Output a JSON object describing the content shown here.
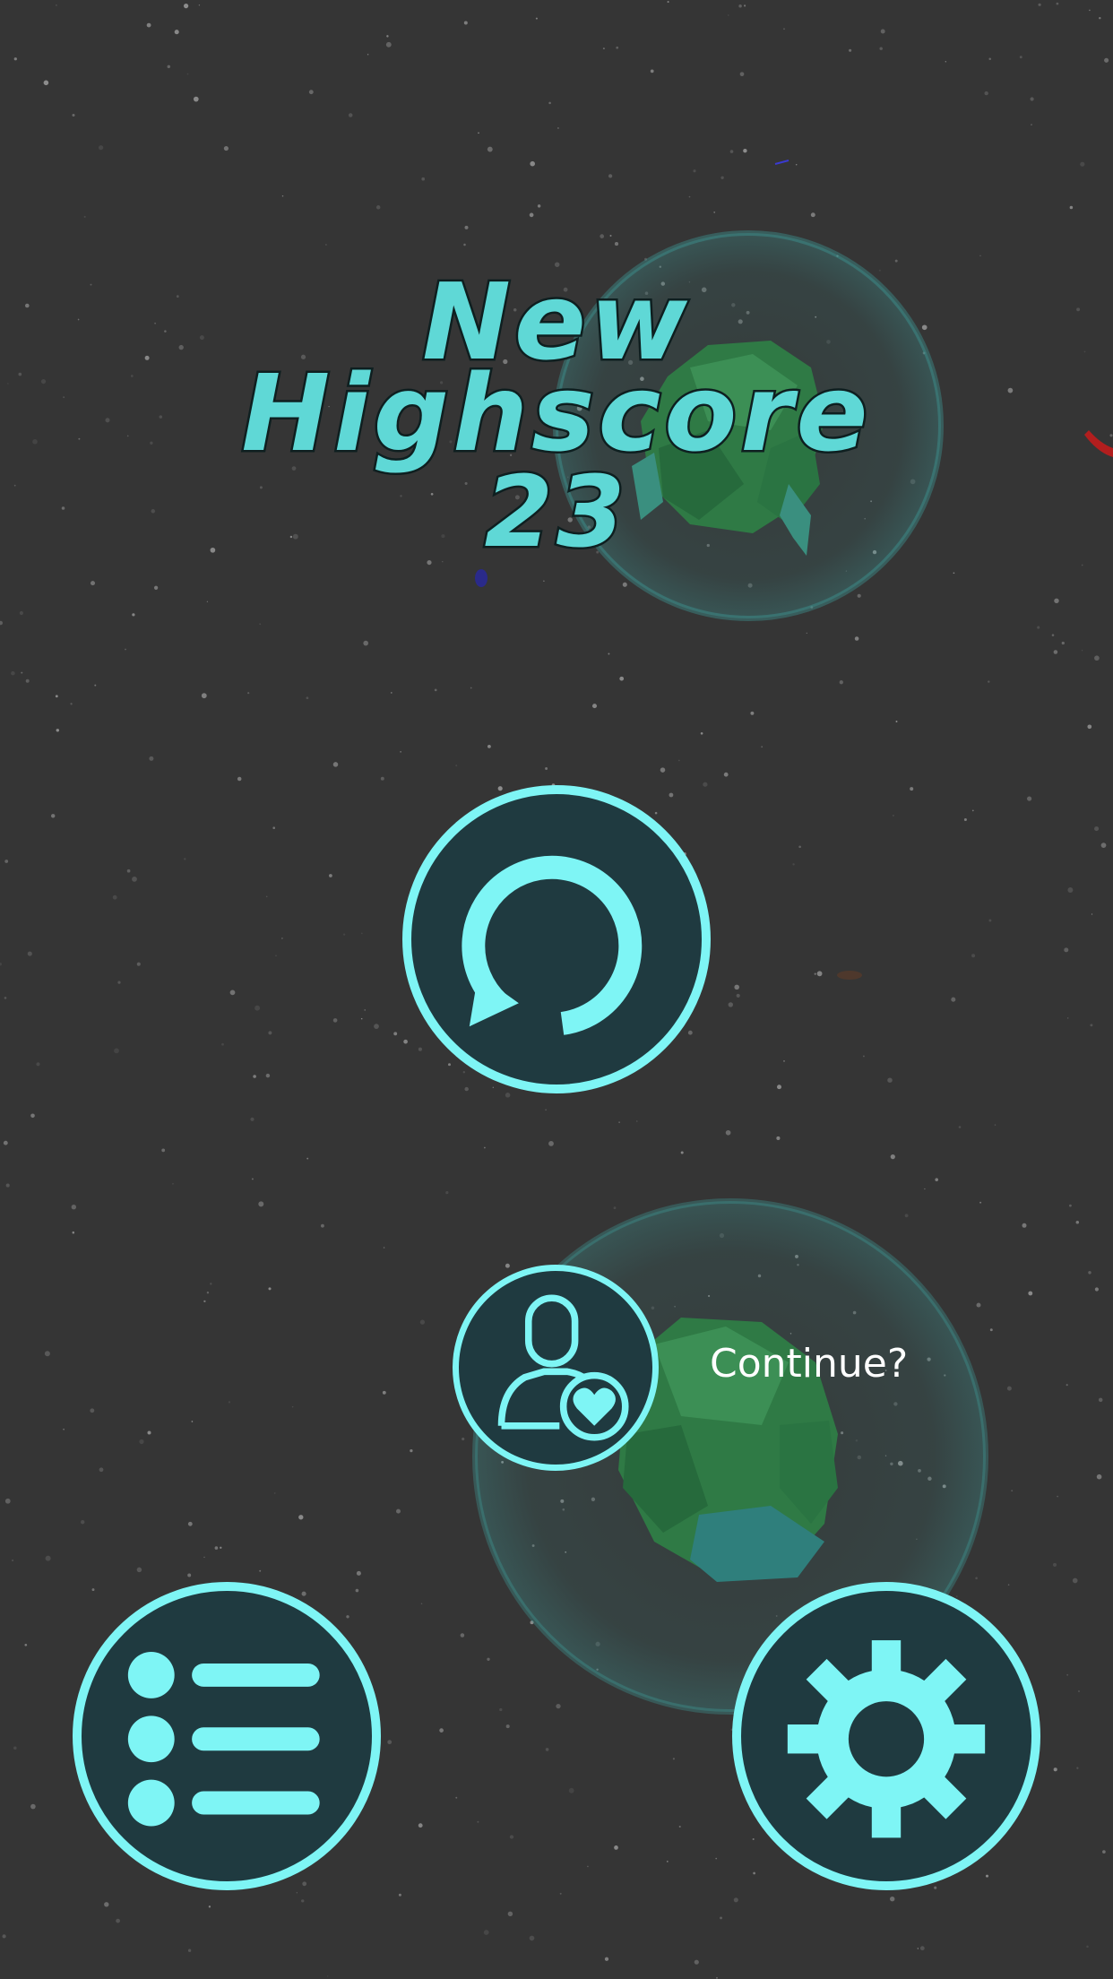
{
  "game": {
    "title_line_1": "New",
    "title_line_2": "Highscore",
    "score": "23"
  },
  "buttons": {
    "restart_icon": "restart-arrow-icon",
    "continue_icon": "user-heart-icon",
    "continue_label": "Continue?",
    "leaderboard_icon": "list-icon",
    "settings_icon": "gear-icon"
  },
  "colors": {
    "background": "#353535",
    "title_fill": "#5fd8d6",
    "title_outline": "#0e1f20",
    "button_ring": "#7ef5f5",
    "button_fill": "#1f3a40",
    "label_text": "#ffffff",
    "bubble": "#3fa8a6",
    "asteroid": "#2f7a45"
  }
}
